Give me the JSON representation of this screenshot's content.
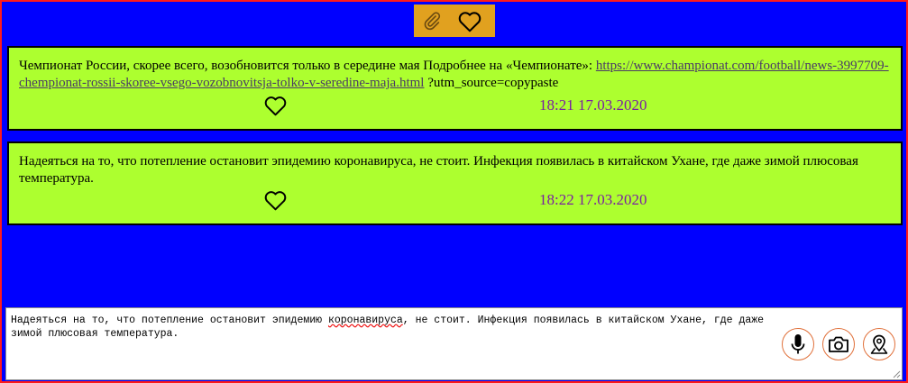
{
  "toolbar": {
    "attach_icon": "paperclip-icon",
    "favorite_icon": "heart-outline-icon",
    "colors": {
      "background": "#e1a11f"
    }
  },
  "colors": {
    "frame_border": "#ff1a1a",
    "background": "#0000ff",
    "card": "#adff2f",
    "timestamp": "#7b1fa2",
    "button_border": "#e0703a"
  },
  "messages": [
    {
      "text_before_link": "Чемпионат России, скорее всего, возобновится только в середине мая Подробнее на «Чемпионате»: ",
      "link_text": "https://www.championat.com/football/news-3997709-chempionat-rossii-skoree-vsego-vozobnovitsja-tolko-v-seredine-maja.html",
      "text_after_link": " ?utm_source=copypaste",
      "like_icon": "heart-outline-icon",
      "time": "18:21 17.03.2020"
    },
    {
      "text": "Надеяться на то, что потепление остановит эпидемию коронавируса, не стоит. Инфекция появилась в китайском Ухане, где даже зимой плюсовая температура.",
      "like_icon": "heart-outline-icon",
      "time": "18:22 17.03.2020"
    }
  ],
  "composer": {
    "value_part1": "Надеяться на то, что потепление остановит эпидемию ",
    "value_misspelled": "коронавируса",
    "value_part2": ", не стоит. Инфекция появилась в китайском Ухане, где даже\nзимой плюсовая температура.",
    "buttons": [
      {
        "icon": "microphone-icon"
      },
      {
        "icon": "camera-icon"
      },
      {
        "icon": "location-pin-icon"
      }
    ]
  }
}
